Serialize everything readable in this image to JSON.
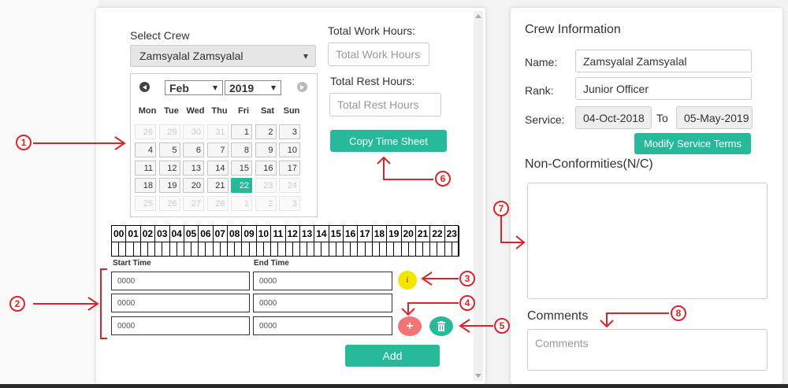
{
  "timesheet": {
    "select_crew_label": "Select Crew",
    "selected_crew": "Zamsyalal Zamsyalal",
    "total_work_hours_label": "Total Work Hours:",
    "total_work_hours_placeholder": "Total Work Hours",
    "total_rest_hours_label": "Total Rest Hours:",
    "total_rest_hours_placeholder": "Total Rest Hours",
    "copy_time_sheet_label": "Copy Time Sheet",
    "calendar": {
      "month": "Feb",
      "year": "2019",
      "weekdays": [
        "Mon",
        "Tue",
        "Wed",
        "Thu",
        "Fri",
        "Sat",
        "Sun"
      ],
      "days": [
        [
          "26",
          "29",
          "30",
          "31",
          "1",
          "2",
          "3"
        ],
        [
          "4",
          "5",
          "6",
          "7",
          "8",
          "9",
          "10"
        ],
        [
          "11",
          "12",
          "13",
          "14",
          "15",
          "16",
          "17"
        ],
        [
          "18",
          "19",
          "20",
          "21",
          "22",
          "23",
          "24"
        ],
        [
          "25",
          "26",
          "27",
          "28",
          "1",
          "2",
          "3"
        ]
      ],
      "selected_day": "22"
    },
    "hours": [
      "00",
      "01",
      "02",
      "03",
      "04",
      "05",
      "06",
      "07",
      "08",
      "09",
      "10",
      "11",
      "12",
      "13",
      "14",
      "15",
      "16",
      "17",
      "18",
      "19",
      "20",
      "21",
      "22",
      "23"
    ],
    "start_time_label": "Start Time",
    "end_time_label": "End Time",
    "rows": [
      {
        "start": "0000",
        "end": "0000"
      },
      {
        "start": "0000",
        "end": "0000"
      },
      {
        "start": "0000",
        "end": "0000"
      }
    ],
    "info_icon": "i",
    "add_label": "Add"
  },
  "crew_info": {
    "title": "Crew Information",
    "name_label": "Name:",
    "name_value": "Zamsyalal  Zamsyalal",
    "rank_label": "Rank:",
    "rank_value": "Junior Officer",
    "service_label": "Service:",
    "service_from": "04-Oct-2018",
    "to_label": "To",
    "service_to": "05-May-2019",
    "modify_label": "Modify Service Terms",
    "nc_label": "Non-Conformities(N/C)",
    "comments_label": "Comments",
    "comments_placeholder": "Comments"
  },
  "annotations": [
    "1",
    "2",
    "3",
    "4",
    "5",
    "6",
    "7",
    "8"
  ],
  "colors": {
    "accent": "#26b99a",
    "annotation": "#d9242b",
    "info": "#f2e600",
    "add_row": "#f27474"
  }
}
